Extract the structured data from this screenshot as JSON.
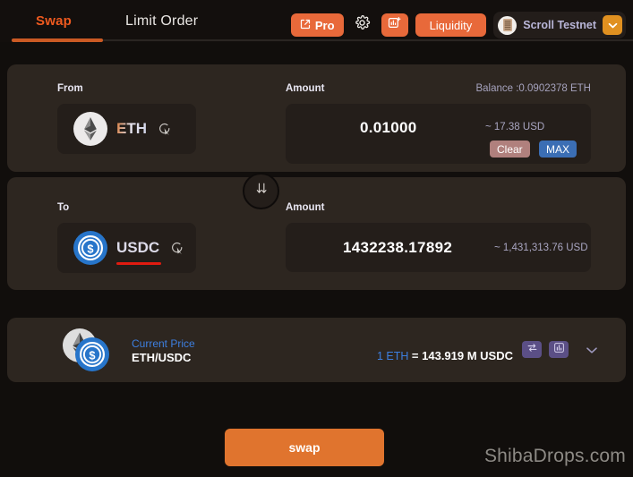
{
  "header": {
    "tabs": [
      {
        "label": "Swap",
        "active": true
      },
      {
        "label": "Limit Order",
        "active": false
      }
    ],
    "pro_label": "Pro",
    "pro_icon": "external-link-icon",
    "settings_icon": "gear-icon",
    "chart_add_icon": "chart-add-icon",
    "liquidity_label": "Liquidity",
    "wallet_name": "Scroll Testnet",
    "wallet_avatar_icon": "wallet-avatar-icon",
    "wallet_caret_icon": "chevron-down-icon"
  },
  "from": {
    "label": "From",
    "token_symbol": "ETH",
    "token_icon": "eth-coin-icon",
    "picker_icon": "token-picker-cursor-icon",
    "amount_label": "Amount",
    "balance_text": "Balance :0.0902378 ETH",
    "amount_value": "0.01000",
    "amount_usd": "~ 17.38 USD",
    "clear_label": "Clear",
    "max_label": "MAX"
  },
  "swap_direction_icon": "double-down-arrow-icon",
  "to": {
    "label": "To",
    "token_symbol": "USDC",
    "token_icon": "usdc-coin-icon",
    "picker_icon": "token-picker-cursor-icon",
    "amount_label": "Amount",
    "amount_value": "1432238.17892",
    "amount_usd": "~ 1,431,313.76 USD"
  },
  "price": {
    "title": "Current Price",
    "pair": "ETH/USDC",
    "rate_from": "1 ETH",
    "rate_to": "= 143.919 M USDC",
    "invert_icon": "swap-arrows-icon",
    "chart_icon": "bar-chart-icon",
    "expand_icon": "chevron-down-icon",
    "eth_icon": "eth-coin-icon",
    "usdc_icon": "usdc-coin-icon"
  },
  "action": {
    "swap_label": "swap"
  },
  "watermark": "ShibaDrops.com",
  "colors": {
    "accent": "#e8693a",
    "page_bg": "#110e0c",
    "panel_bg": "#2d2620",
    "card_bg": "#241e1a",
    "link_blue": "#3d7fe0",
    "max_blue": "#3b6eb4",
    "clear_rose": "#b0807d",
    "pill_purple": "#5b4f86",
    "usdc_underline_red": "#e01b10",
    "wallet_caret_amber": "#e09020"
  }
}
